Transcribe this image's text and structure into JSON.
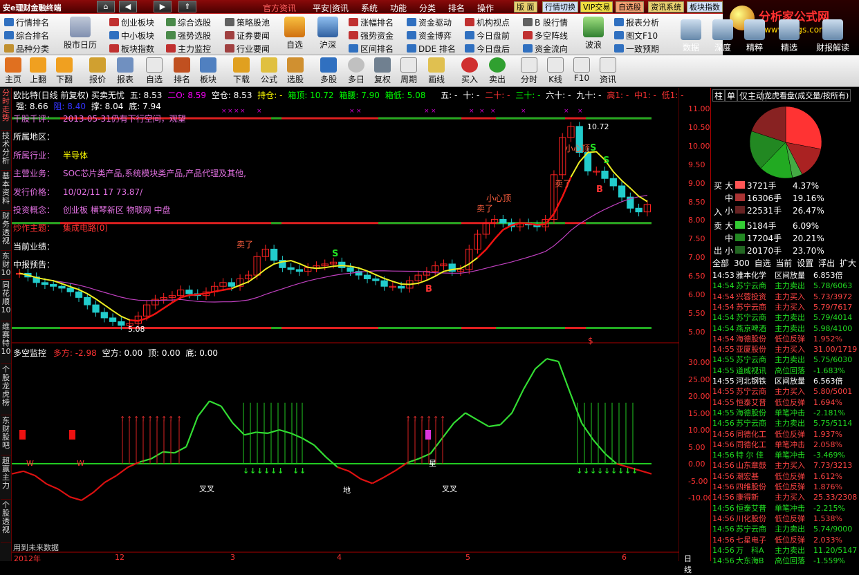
{
  "app": {
    "title": "安e理财金融终端"
  },
  "menubar": {
    "items": [
      "官方资讯",
      "平安|资讯",
      "系统",
      "功能",
      "分类",
      "排名",
      "操作"
    ],
    "quick": [
      "版 面",
      "行情切换",
      "VIP交易",
      "自选股",
      "资讯系统",
      "板块指数"
    ]
  },
  "logo": {
    "title": "分析家公式网",
    "url": "www.88gs.com"
  },
  "toolbar1": {
    "left": [
      "行情排名",
      "综合排名",
      "品种分类"
    ],
    "calendar": "股市日历",
    "col2": [
      "创业板块",
      "中小板块",
      "板块指数"
    ],
    "col3": [
      "综合选股",
      "强势选股",
      "主力监控"
    ],
    "col4": [
      "策略股池",
      "证券要闻",
      "行业要闻"
    ],
    "zixuan": "自选",
    "husheng": "沪深",
    "col5": [
      "涨幅排名",
      "强势资金",
      "区间排名"
    ],
    "col6": [
      "资金驱动",
      "资金博弈",
      "DDE 排名"
    ],
    "col7": [
      "机构视点",
      "今日盘前",
      "今日盘后"
    ],
    "col8": [
      "B 股行情",
      "多空阵线",
      "资金流向"
    ],
    "bolang": "波浪",
    "col9": [
      "报表分析",
      "图文F10",
      "一致预期"
    ],
    "right": [
      "数据",
      "深度",
      "精粹",
      "精选",
      "财报解读"
    ]
  },
  "toolbar2": [
    "主页",
    "上翻",
    "下翻",
    "报价",
    "报表",
    "自选",
    "排名",
    "板块",
    "下载",
    "公式",
    "选股",
    "多股",
    "多日",
    "复权",
    "周期",
    "画线",
    "买入",
    "卖出",
    "分时",
    "K线",
    "F10",
    "资讯"
  ],
  "left_tabs": [
    "分时走势",
    "技术分析",
    "基本资料",
    "财务透视",
    "东财10",
    "同花顺10",
    "维赛特10",
    "个股龙虎榜",
    "东财股吧",
    "超赢主力",
    "个股透视"
  ],
  "chart": {
    "header1": [
      "欧比特(日线 前复权) 买卖无忧",
      "五: 8.53",
      "二O: 8.59",
      "空仓: 8.53",
      "持仓: -",
      "箱顶: 10.72",
      "箱腰: 7.90",
      "箱低: 5.08",
      "五: -",
      "十: -",
      "二十: -",
      "三十: -",
      "六十: -",
      "九十: -",
      "高1: -",
      "中1: -",
      "低1: -"
    ],
    "header2": [
      "强: 8.66",
      "阻: 8.40",
      "撑: 8.04",
      "底: 7.94"
    ],
    "info": [
      {
        "label": "千股千评：",
        "value": "2013-05-31仍有下行空间，观望"
      },
      {
        "label": "所属地区：",
        "value": ""
      },
      {
        "label": "所属行业：",
        "value": "半导体"
      },
      {
        "label": "主营业务：",
        "value": "SOC芯片类产品,系统模块类产品,产品代理及其他,"
      },
      {
        "label": "发行价格：",
        "value": "10/02/11 17 73.87/"
      },
      {
        "label": "投资概念：",
        "value": "创业板 横琴新区 物联网 中盘"
      },
      {
        "label": "炒作主题：",
        "value": "集成电路(0)"
      },
      {
        "label": "当前业绩：",
        "value": ""
      },
      {
        "label": "中报预告：",
        "value": ""
      }
    ],
    "annotations": {
      "high": "10.72",
      "low": "5.08",
      "sell1": "卖了",
      "sell2": "卖了",
      "sell3": "卖了",
      "caution1": "小心顶",
      "caution2": "小心顶",
      "S": "S",
      "B": "B",
      "dollar": "$"
    },
    "price_ticks": [
      "11.00",
      "10.50",
      "10.00",
      "9.50",
      "9.00",
      "8.50",
      "8.00",
      "7.50",
      "7.00",
      "6.50",
      "6.00",
      "5.50",
      "5.00"
    ],
    "sub_title": "多空监控",
    "sub_values": [
      "多方: -2.98",
      "空方: 0.00",
      "顶: 0.00",
      "底: 0.00"
    ],
    "sub_ticks": [
      "30.00",
      "25.00",
      "20.00",
      "15.00",
      "10.00",
      "5.00",
      "0.00",
      "-5.00",
      "-10.00"
    ],
    "sub_labels": {
      "w1": "W",
      "w2": "W",
      "cross1": "叉叉",
      "cross2": "叉叉",
      "di": "地",
      "star": "星"
    },
    "footer_note": "用到未来数据",
    "x_labels": [
      "2012年",
      "12",
      "3",
      "4",
      "5",
      "6"
    ],
    "period": "日线"
  },
  "chart_data": {
    "type": "line",
    "title": "欧比特(日线 前复权) 买卖无忧",
    "ylim": [
      4.8,
      11.2
    ],
    "box": {
      "top": 10.72,
      "mid": 7.9,
      "low": 5.08
    },
    "close": [
      6.55,
      6.45,
      6.3,
      6.25,
      6.2,
      6.15,
      6.05,
      5.9,
      5.7,
      5.5,
      5.35,
      5.25,
      5.15,
      5.2,
      5.4,
      5.7,
      5.85,
      5.9,
      5.95,
      6.1,
      6.0,
      5.95,
      6.05,
      6.2,
      6.3,
      6.2,
      6.4,
      6.5,
      7.0,
      7.2,
      6.9,
      6.7,
      6.65,
      6.6,
      6.7,
      6.75,
      6.8,
      6.85,
      6.7,
      6.6,
      6.5,
      6.4,
      6.35,
      6.2,
      6.2,
      6.15,
      6.35,
      6.5,
      6.6,
      6.75,
      6.8,
      6.6,
      6.65,
      7.2,
      7.6,
      7.9,
      8.0,
      7.9,
      7.8,
      7.9,
      7.85,
      7.8,
      8.0,
      9.2,
      10.2,
      10.5,
      9.8,
      9.3,
      9.3,
      9.1,
      8.9,
      8.6,
      8.3,
      8.2,
      8.4
    ],
    "x_months": [
      "2012年",
      "12",
      "3",
      "4",
      "5",
      "6"
    ],
    "sub_ylim": [
      -13,
      33
    ],
    "sub_series": [
      -3,
      -2.2,
      -3.5,
      -6,
      -7.5,
      -9.8,
      -10.8,
      -8.5,
      -5.5,
      -3.5,
      -1,
      0.5,
      1.5,
      3.5,
      3.2,
      5,
      14,
      18.5,
      17,
      12,
      8.5,
      9.3,
      9,
      10,
      9,
      7.5,
      5.5,
      2,
      -1,
      -2.2,
      -4.5,
      -5.8,
      -4,
      -2,
      0.3,
      1.5,
      3,
      7.5,
      12,
      15,
      13,
      11,
      11.5,
      15,
      22,
      28,
      31,
      30.2,
      21,
      12,
      7,
      3,
      0,
      -1,
      -2,
      -3
    ]
  },
  "right_panel": {
    "tabs": [
      "柱",
      "单",
      "仅主动",
      "龙虎看盘(成交量/按所有)"
    ],
    "pie": [
      37.21,
      19.16,
      6.09,
      20.21,
      23.7,
      26.47
    ],
    "buy_label": "买",
    "sell_label": "卖",
    "in_label": "入",
    "out_label": "出",
    "buy": [
      {
        "size": "大",
        "vol": "3721手",
        "pct": "4.37%"
      },
      {
        "size": "中",
        "vol": "16306手",
        "pct": "19.16%"
      },
      {
        "size": "小",
        "vol": "22531手",
        "pct": "26.47%"
      }
    ],
    "sell": [
      {
        "size": "大",
        "vol": "5184手",
        "pct": "6.09%"
      },
      {
        "size": "中",
        "vol": "17204手",
        "pct": "20.21%"
      },
      {
        "size": "小",
        "vol": "20170手",
        "pct": "23.70%"
      }
    ],
    "filters": [
      "全部",
      "300",
      "自选",
      "当前",
      "设置",
      "浮出",
      "扩大"
    ],
    "trades": [
      {
        "time": "14:53",
        "name": "雅本化学",
        "type": "区间放量",
        "val": "6.853倍",
        "c": "w"
      },
      {
        "time": "14:54",
        "name": "苏宁云商",
        "type": "主力卖出",
        "val": "5.78/6063",
        "c": "g"
      },
      {
        "time": "14:54",
        "name": "兴蓉投资",
        "type": "主力买入",
        "val": "5.73/3972",
        "c": "r"
      },
      {
        "time": "14:54",
        "name": "苏宁云商",
        "type": "主力买入",
        "val": "5.79/7617",
        "c": "r"
      },
      {
        "time": "14:54",
        "name": "苏宁云商",
        "type": "主力卖出",
        "val": "5.79/4014",
        "c": "g"
      },
      {
        "time": "14:54",
        "name": "燕京啤酒",
        "type": "主力卖出",
        "val": "5.98/4100",
        "c": "g"
      },
      {
        "time": "14:54",
        "name": "海德股份",
        "type": "低位反弹",
        "val": "1.952%",
        "c": "r"
      },
      {
        "time": "14:55",
        "name": "亚厦股份",
        "type": "主力买入",
        "val": "31.00/1719",
        "c": "r"
      },
      {
        "time": "14:55",
        "name": "苏宁云商",
        "type": "主力卖出",
        "val": "5.75/6030",
        "c": "g"
      },
      {
        "time": "14:55",
        "name": "道威视讯",
        "type": "高位回落",
        "val": "-1.683%",
        "c": "g"
      },
      {
        "time": "14:55",
        "name": "河北钢铁",
        "type": "区间放量",
        "val": "6.563倍",
        "c": "w"
      },
      {
        "time": "14:55",
        "name": "苏宁云商",
        "type": "主力买入",
        "val": "5.80/5001",
        "c": "r"
      },
      {
        "time": "14:55",
        "name": "恒泰艾普",
        "type": "低位反弹",
        "val": "1.694%",
        "c": "r"
      },
      {
        "time": "14:55",
        "name": "海德股份",
        "type": "单笔冲击",
        "val": "-2.181%",
        "c": "g"
      },
      {
        "time": "14:56",
        "name": "苏宁云商",
        "type": "主力卖出",
        "val": "5.75/5114",
        "c": "g"
      },
      {
        "time": "14:56",
        "name": "同德化工",
        "type": "低位反弹",
        "val": "1.937%",
        "c": "r"
      },
      {
        "time": "14:56",
        "name": "同德化工",
        "type": "单笔冲击",
        "val": "2.058%",
        "c": "r"
      },
      {
        "time": "14:56",
        "name": "特 尔 佳",
        "type": "单笔冲击",
        "val": "-3.469%",
        "c": "g"
      },
      {
        "time": "14:56",
        "name": "山东章鼓",
        "type": "主力买入",
        "val": "7.73/3213",
        "c": "r"
      },
      {
        "time": "14:56",
        "name": "潮宏基",
        "type": "低位反弹",
        "val": "1.612%",
        "c": "r"
      },
      {
        "time": "14:56",
        "name": "四维股份",
        "type": "低位反弹",
        "val": "1.876%",
        "c": "r"
      },
      {
        "time": "14:56",
        "name": "康得新",
        "type": "主力买入",
        "val": "25.33/2308",
        "c": "r"
      },
      {
        "time": "14:56",
        "name": "恒泰艾普",
        "type": "单笔冲击",
        "val": "-2.215%",
        "c": "g"
      },
      {
        "time": "14:56",
        "name": "川化股份",
        "type": "低位反弹",
        "val": "1.538%",
        "c": "r"
      },
      {
        "time": "14:56",
        "name": "苏宁云商",
        "type": "主力卖出",
        "val": "5.74/9000",
        "c": "g"
      },
      {
        "time": "14:56",
        "name": "七星电子",
        "type": "低位反弹",
        "val": "2.033%",
        "c": "r"
      },
      {
        "time": "14:56",
        "name": "万　科A",
        "type": "主力卖出",
        "val": "11.20/5147",
        "c": "g"
      },
      {
        "time": "14:56",
        "name": "大东海B",
        "type": "高位回落",
        "val": "-1.559%",
        "c": "g"
      }
    ]
  }
}
